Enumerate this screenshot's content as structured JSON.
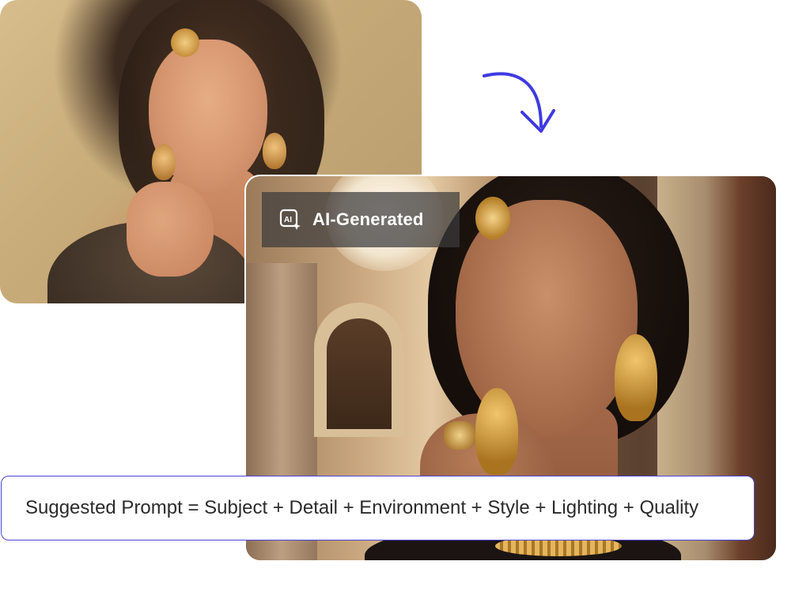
{
  "images": {
    "source": {
      "description_role": "original-painting"
    },
    "result": {
      "description_role": "ai-generated-photo"
    }
  },
  "badge": {
    "label": "AI-Generated",
    "icon": "ai-sparkle-icon"
  },
  "arrow": {
    "icon": "curved-arrow-down-icon",
    "color": "#3f3ae0"
  },
  "prompt": {
    "text": "Suggested Prompt = Subject + Detail + Environment + Style + Lighting + Quality",
    "border_color": "#4b45d6"
  }
}
